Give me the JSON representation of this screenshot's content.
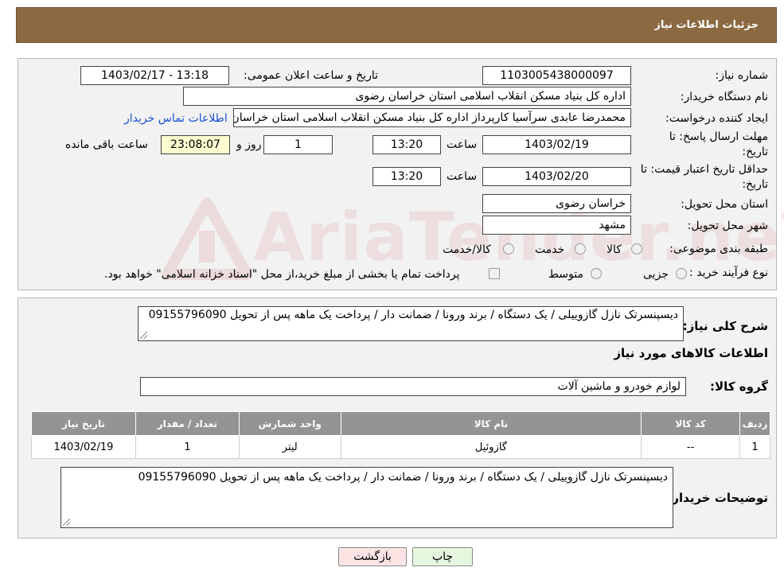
{
  "header": {
    "title": "جزئیات اطلاعات نیاز"
  },
  "form": {
    "need_number_label": "شماره نیاز:",
    "need_number": "1103005438000097",
    "announce_label": "تاریخ و ساعت اعلان عمومی:",
    "announce_value": "1403/02/17 - 13:18",
    "buyer_org_label": "نام دستگاه خریدار:",
    "buyer_org": "اداره کل بنیاد مسکن انقلاب اسلامی استان خراسان رضوی",
    "creator_label": "ایجاد کننده درخواست:",
    "creator": "محمدرضا عابدی سرآسیا کارپرداز اداره کل بنیاد مسکن انقلاب اسلامی استان خراسان رضوی",
    "contact_link": "اطلاعات تماس خریدار",
    "reply_deadline_label_1": "مهلت ارسال پاسخ: تا",
    "reply_deadline_label_2": "تاریخ:",
    "reply_date": "1403/02/19",
    "time_label": "ساعت",
    "reply_time": "13:20",
    "days_value": "1",
    "days_label": "روز و",
    "remaining_time": "23:08:07",
    "remaining_label": "ساعت باقی مانده",
    "validity_label_1": "حداقل تاریخ اعتبار قیمت: تا",
    "validity_label_2": "تاریخ:",
    "validity_date": "1403/02/20",
    "validity_time": "13:20",
    "province_label": "استان محل تحویل:",
    "province": "خراسان رضوی",
    "city_label": "شهر محل تحویل:",
    "city": "مشهد",
    "category_label": "طبقه بندی موضوعی:",
    "category_options": [
      "کالا",
      "خدمت",
      "کالا/خدمت"
    ],
    "process_label": "نوع فرآیند خرید :",
    "process_options": [
      "جزیی",
      "متوسط"
    ],
    "payment_note": "پرداخت تمام یا بخشی از مبلغ خرید،از محل \"اسناد خزانه اسلامی\" خواهد بود."
  },
  "description": {
    "label": "شرح کلی نیاز:",
    "text": "دیسپنسرتک نازل گازوییلی / یک دستگاه / برند ورونا / ضمانت دار / پرداخت یک ماهه پس از تحویل 09155796090",
    "items_title": "اطلاعات کالاهای مورد نیاز",
    "group_label": "گروه کالا:",
    "group_value": "لوازم خودرو و ماشین آلات"
  },
  "table": {
    "headers": [
      "ردیف",
      "کد کالا",
      "نام کالا",
      "واحد شمارش",
      "تعداد / مقدار",
      "تاریخ نیاز"
    ],
    "rows": [
      [
        "1",
        "--",
        "گازوئیل",
        "لیتر",
        "1",
        "1403/02/19"
      ]
    ]
  },
  "buyer_notes": {
    "label": "توضیحات خریدار:",
    "text": "دیسپنسرتک نازل گازوییلی / یک دستگاه / برند ورونا / ضمانت دار / پرداخت یک ماهه پس از تحویل 09155796090"
  },
  "buttons": {
    "print": "چاپ",
    "back": "بازگشت"
  },
  "watermark": "AriaTender.neT",
  "colors": {
    "header_bg": "#8b6a42",
    "table_header_bg": "#949494",
    "back_button_bg": "#fde4e4",
    "print_button_bg": "#e6f7df",
    "link": "#1a4fd6"
  }
}
